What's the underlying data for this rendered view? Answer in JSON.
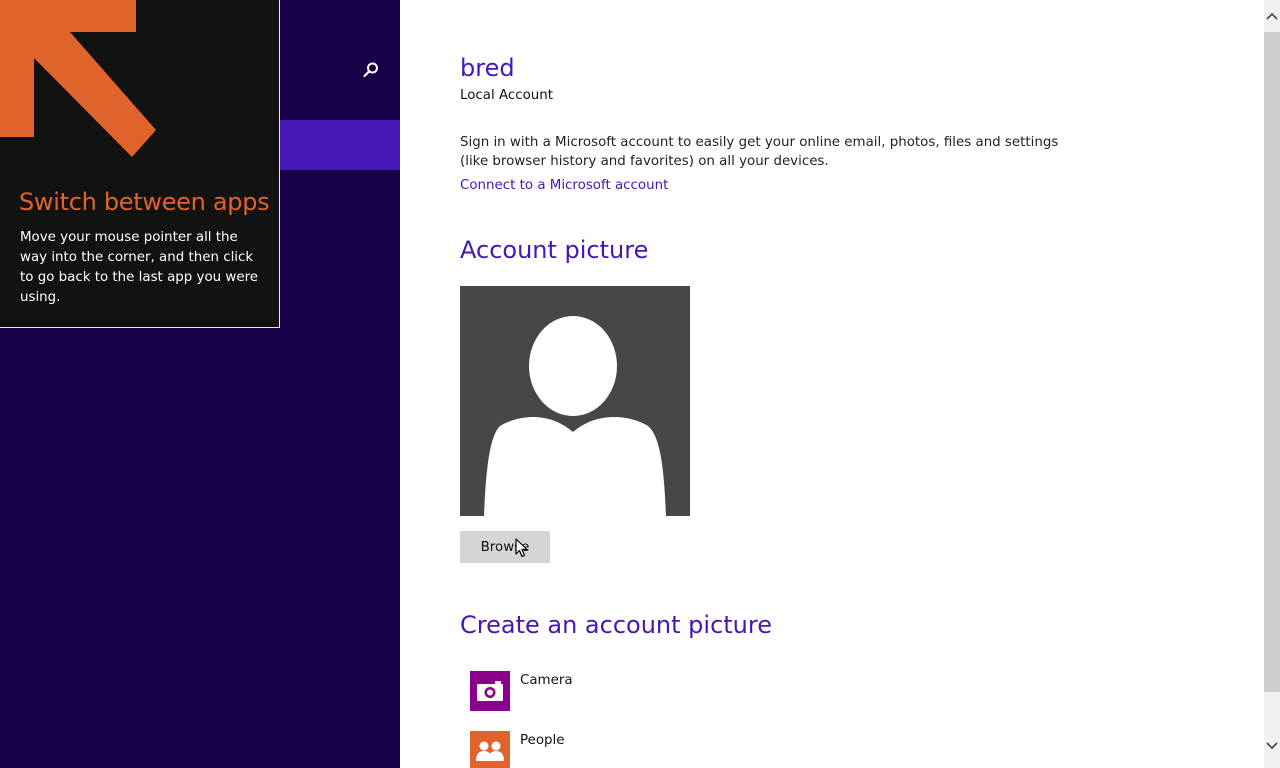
{
  "colors": {
    "sidebar_bg": "#180048",
    "accent": "#4617b4",
    "tip_bg": "#121212",
    "tip_accent": "#e0632c",
    "avatar_bg": "#474747",
    "camera_tile": "#8b008b",
    "people_tile": "#e0632c"
  },
  "sidebar": {
    "search_icon": "magnifier-icon"
  },
  "tip": {
    "arrow_icon": "arrow-up-left-icon",
    "title": "Switch between apps",
    "body": "Move your mouse pointer all the way into the corner, and then click to go back to the last app you were using."
  },
  "account": {
    "name": "bred",
    "type": "Local Account",
    "signin_text": "Sign in with a Microsoft account to easily get your online email, photos, files and settings (like browser history and favorites) on all your devices.",
    "connect_link": "Connect to a Microsoft account"
  },
  "account_picture": {
    "heading": "Account picture",
    "avatar_icon": "default-user-silhouette",
    "browse_label": "Browse"
  },
  "create_picture": {
    "heading": "Create an account picture",
    "items": [
      {
        "label": "Camera",
        "icon": "camera-icon"
      },
      {
        "label": "People",
        "icon": "people-icon"
      }
    ]
  }
}
